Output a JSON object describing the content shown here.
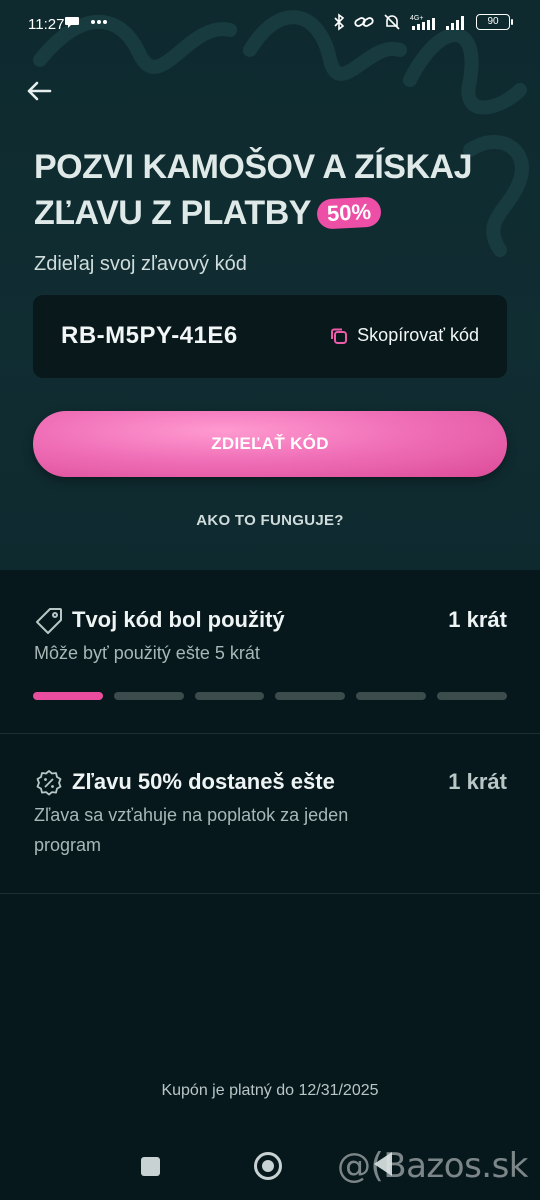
{
  "status_bar": {
    "time": "11:27",
    "left_icons": [
      "chat-bubble-icon",
      "more-dots-icon"
    ],
    "right_icons": [
      "bluetooth-icon",
      "link-icon",
      "mute-bell-icon",
      "signal-4g-icon",
      "signal-bars-icon"
    ],
    "network": "4G+",
    "battery": "90"
  },
  "header": {
    "back_icon": "arrow-left-icon",
    "title_line1": "POZVI KAMOŠOV A ZÍSKAJ",
    "title_line2": "ZĽAVU Z PLATBY",
    "badge": "50%"
  },
  "share": {
    "label": "Zdieľaj svoj zľavový kód",
    "code": "RB-M5PY-41E6",
    "copy_label": "Skopírovať kód",
    "copy_icon": "copy-icon",
    "button_label": "ZDIEĽAŤ KÓD",
    "how_it_works": "AKO TO FUNGUJE?"
  },
  "usage": {
    "icon": "tag-icon",
    "title": "Tvoj kód bol použitý",
    "count": "1 krát",
    "subtitle": "Môže byť použitý ešte 5 krát",
    "progress": {
      "used": 1,
      "total": 6
    }
  },
  "discount": {
    "icon": "discount-badge-icon",
    "title": "Zľavu 50% dostaneš ešte",
    "count": "1 krát",
    "subtitle": "Zľava sa vzťahuje na poplatok za jeden program"
  },
  "footer": {
    "validity": "Kupón je platný do 12/31/2025"
  },
  "navbar": {
    "buttons": [
      "recents-button",
      "home-button",
      "back-button"
    ],
    "watermark": "@(Bazos.sk"
  },
  "colors": {
    "accent_pink": "#ea4d9d",
    "hero_bg": "#0f2a2f",
    "page_bg": "#07181c"
  }
}
